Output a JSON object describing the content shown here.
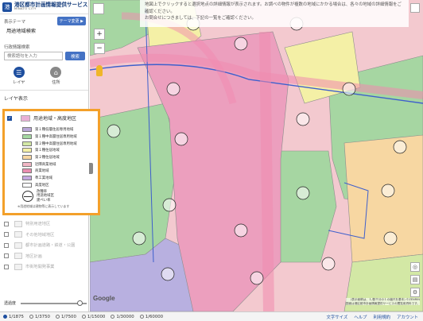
{
  "app": {
    "title": "港区都市計画情報提供サービス",
    "subtitle": "MINATO CITY",
    "logo_glyph": "港"
  },
  "theme": {
    "label": "表示テーマ",
    "change_button": "テーマ変更 ▶",
    "value": "用途地域検索"
  },
  "admin_search": {
    "label": "行政情報検索",
    "placeholder": "検索語句を入力",
    "button": "検索"
  },
  "tools": [
    {
      "label": "レイヤ",
      "icon": "list-icon"
    },
    {
      "label": "住所",
      "icon": "home-icon"
    }
  ],
  "layers_heading": "レイヤ表示",
  "legend": {
    "title": "用途地域・高度地区",
    "items": [
      {
        "label": "第１種低層住居専用地域",
        "color": "#b9a7d8"
      },
      {
        "label": "第１種中高層住居専用地域",
        "color": "#a4d8a1"
      },
      {
        "label": "第２種中高層住居専用地域",
        "color": "#d3e8a5"
      },
      {
        "label": "第１種住居地域",
        "color": "#f4f0a6"
      },
      {
        "label": "第２種住居地域",
        "color": "#f7d7a2"
      },
      {
        "label": "近隣商業地域",
        "color": "#f2b7c5"
      },
      {
        "label": "商業地域",
        "color": "#e98db0"
      },
      {
        "label": "準工業地域",
        "color": "#c4a8e0"
      },
      {
        "label": "高度地区",
        "color": "#ffffff"
      }
    ],
    "symbol_label_lines": [
      "改種率",
      "用途地域区",
      "建ぺい率"
    ],
    "symbol_text": "",
    "note": "※用途地域は建物等に表示しています"
  },
  "other_layers": [
    "特別用途地区",
    "その他地域地区",
    "都市計画道路・鉄道・公園",
    "地区計画",
    "市街地開発事業"
  ],
  "opacity": {
    "label": "透過度",
    "value": 0.9
  },
  "map": {
    "info_text": "地図上でクリックすると選択地点の詳細情報が表示されます。お調べの物件が複数の地域にかかる場合は、各々の地域の詳細情報をご確認ください。",
    "info_text_2": "お問合せにつきましては、下記の一覧をご確認ください。",
    "zoom_in": "+",
    "zoom_out": "−",
    "google": "Google",
    "attribution_1": "(表示面積は、１/数千分の１の縮尺を基本) ©ZENRIN",
    "attribution_2": "図面は港区都市計画情報提供サービスの閲覧用資料です。"
  },
  "bottom": {
    "scales": [
      "1/1875",
      "1/3750",
      "1/7500",
      "1/15000",
      "1/30000",
      "1/60000"
    ],
    "selected_scale": 0,
    "links": [
      "文字サイズ",
      "ヘルプ",
      "利用規約",
      "アカウント"
    ]
  }
}
